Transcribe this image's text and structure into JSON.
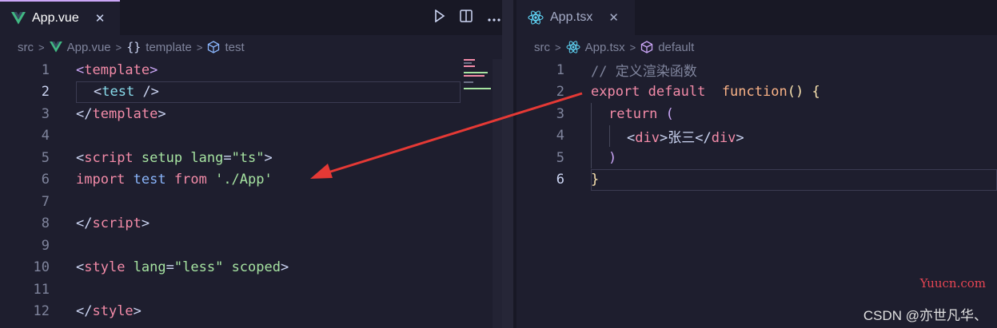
{
  "left": {
    "tab": {
      "label": "App.vue",
      "close": "✕"
    },
    "breadcrumb": {
      "items": [
        "src",
        "App.vue",
        "template",
        "test"
      ]
    },
    "lines": [
      {
        "n": "1"
      },
      {
        "n": "2"
      },
      {
        "n": "3"
      },
      {
        "n": "4"
      },
      {
        "n": "5"
      },
      {
        "n": "6"
      },
      {
        "n": "7"
      },
      {
        "n": "8"
      },
      {
        "n": "9"
      },
      {
        "n": "10"
      },
      {
        "n": "11"
      },
      {
        "n": "12"
      }
    ],
    "code": {
      "l1_open": "<",
      "l1_tag": "template",
      "l1_close": ">",
      "l2_open": "<",
      "l2_tag": "test",
      "l2_close": " />",
      "l3_open": "</",
      "l3_tag": "template",
      "l3_close": ">",
      "l5_open": "<",
      "l5_tag": "script",
      "l5_attr1": "setup",
      "l5_attr2": "lang",
      "l5_eq": "=",
      "l5_str": "\"ts\"",
      "l5_close": ">",
      "l6_kw": "import",
      "l6_id": "test",
      "l6_from": "from",
      "l6_str": "'./App'",
      "l8_open": "</",
      "l8_tag": "script",
      "l8_close": ">",
      "l10_open": "<",
      "l10_tag": "style",
      "l10_attr1": "lang",
      "l10_eq": "=",
      "l10_str": "\"less\"",
      "l10_attr2": "scoped",
      "l10_close": ">",
      "l12_open": "</",
      "l12_tag": "style",
      "l12_close": ">"
    }
  },
  "right": {
    "tab": {
      "label": "App.tsx",
      "close": "✕"
    },
    "breadcrumb": {
      "items": [
        "src",
        "App.tsx",
        "default"
      ]
    },
    "lines": [
      {
        "n": "1"
      },
      {
        "n": "2"
      },
      {
        "n": "3"
      },
      {
        "n": "4"
      },
      {
        "n": "5"
      },
      {
        "n": "6"
      }
    ],
    "code": {
      "l1_comment": "// 定义渲染函数",
      "l2_export": "export",
      "l2_default": "default",
      "l2_function": "function",
      "l2_paren": "()",
      "l2_brace": "{",
      "l3_return": "return",
      "l3_paren": "(",
      "l4_open": "<",
      "l4_tag": "div",
      "l4_gt": ">",
      "l4_text": "张三",
      "l4_close_open": "</",
      "l4_close_tag": "div",
      "l4_close_gt": ">",
      "l5_paren": ")",
      "l6_brace": "}"
    }
  },
  "watermarks": {
    "site": "Yuucn.com",
    "author": "CSDN @亦世凡华、"
  },
  "colors": {
    "background": "#1e1e2e",
    "tag": "#f38ba8",
    "attr": "#a6e3a1",
    "keyword": "#cba6f7",
    "identifier": "#89b4fa",
    "function": "#fab387",
    "arrow": "#e53935"
  }
}
